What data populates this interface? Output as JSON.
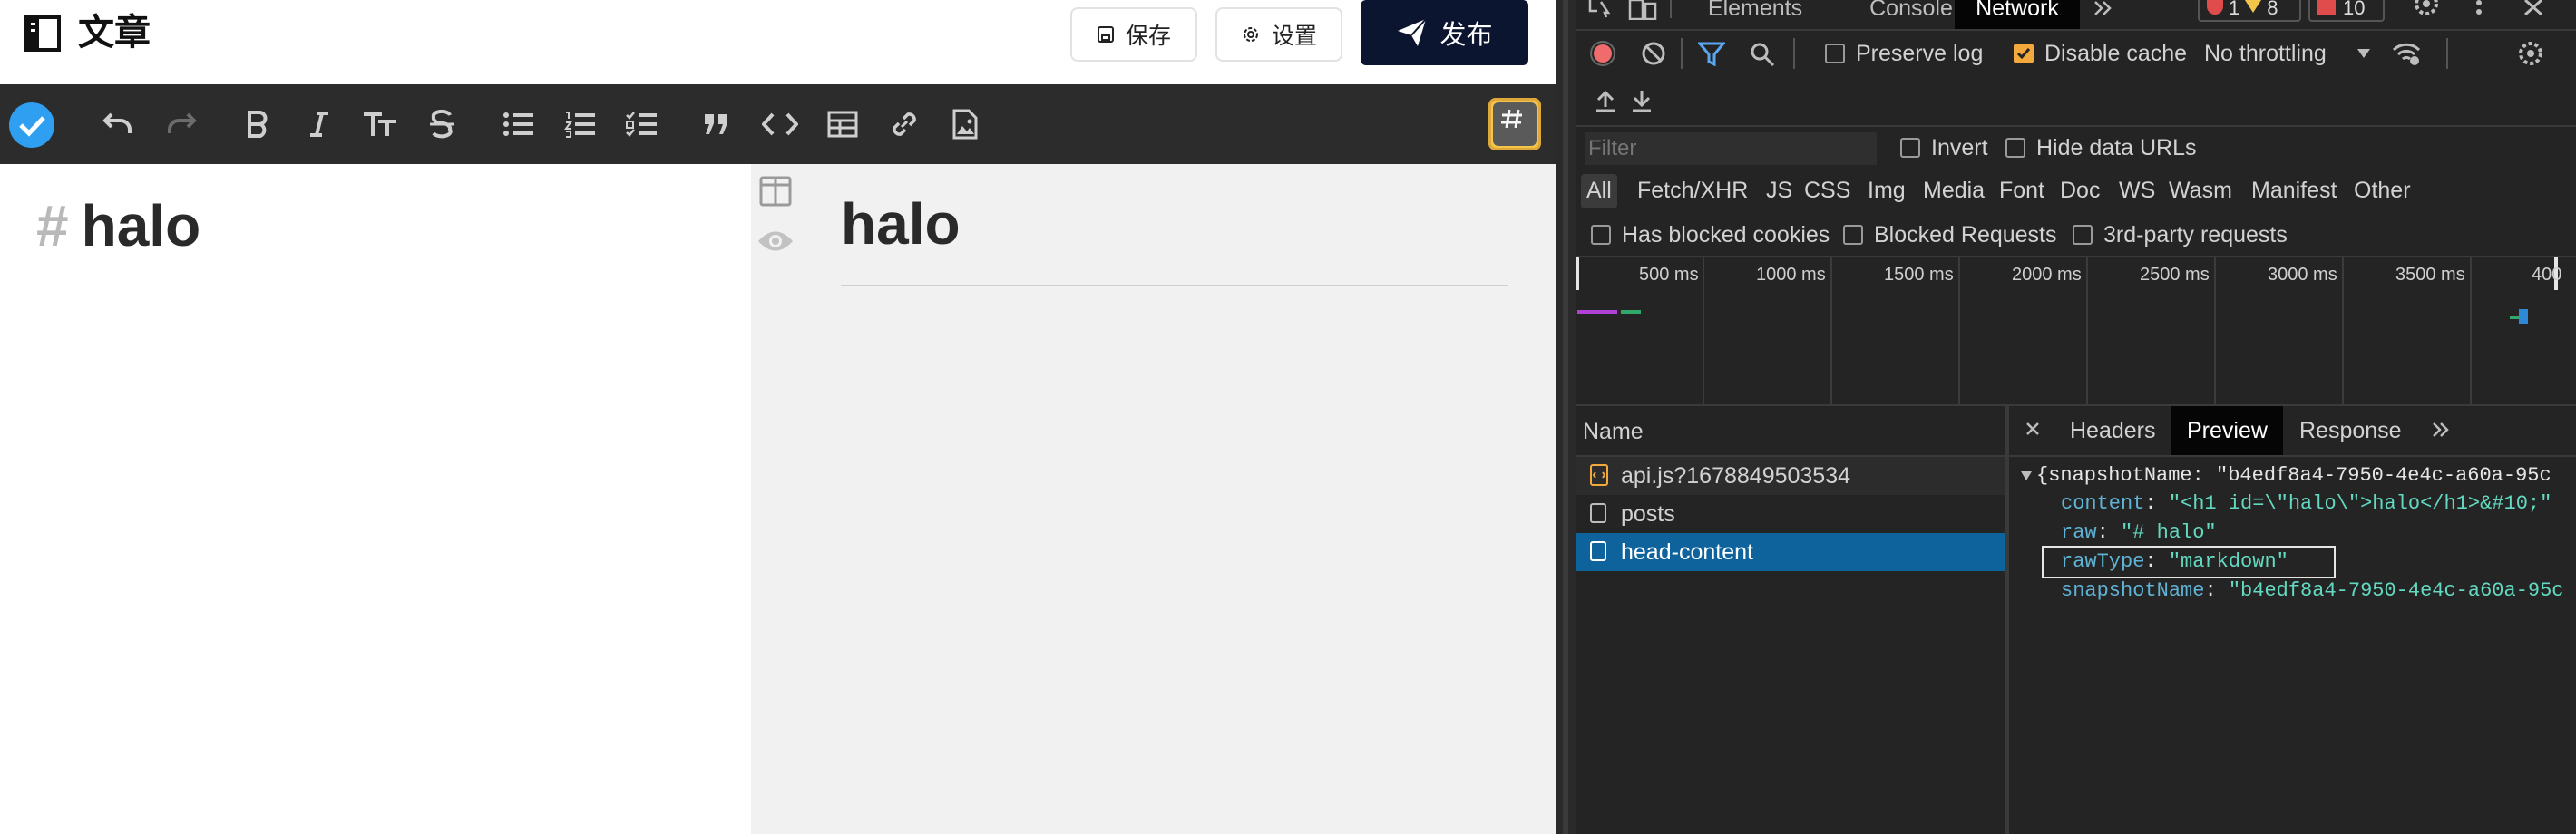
{
  "app": {
    "page_title": "文章",
    "buttons": {
      "save": "保存",
      "settings": "设置",
      "publish": "发布"
    },
    "editor": {
      "hash": "#",
      "heading": "halo"
    },
    "preview": {
      "heading": "halo"
    }
  },
  "devtools": {
    "tabs": [
      "Elements",
      "Console",
      "Network"
    ],
    "active_tab": "Network",
    "counts": {
      "errors": "1",
      "warnings": "8",
      "issues": "10"
    },
    "toolbar": {
      "preserve_log": "Preserve log",
      "disable_cache": "Disable cache",
      "throttling": "No throttling"
    },
    "filter": {
      "placeholder": "Filter",
      "invert": "Invert",
      "hide_data_urls": "Hide data URLs"
    },
    "types": [
      "All",
      "Fetch/XHR",
      "JS",
      "CSS",
      "Img",
      "Media",
      "Font",
      "Doc",
      "WS",
      "Wasm",
      "Manifest",
      "Other"
    ],
    "checks": {
      "blocked_cookies": "Has blocked cookies",
      "blocked_requests": "Blocked Requests",
      "third_party": "3rd-party requests"
    },
    "timeline_ticks": [
      "500 ms",
      "1000 ms",
      "1500 ms",
      "2000 ms",
      "2500 ms",
      "3000 ms",
      "3500 ms",
      "400"
    ],
    "requests": {
      "header": "Name",
      "items": [
        "api.js?1678849503534",
        "posts",
        "head-content"
      ],
      "selected": "head-content"
    },
    "detail_tabs": {
      "headers": "Headers",
      "preview": "Preview",
      "response": "Response"
    },
    "preview": {
      "root_open": "{snapshotName: \"b4edf8a4-7950-4e4c-a60a-95c",
      "rows": [
        {
          "key": "content",
          "value": "\"<h1 id=\\\"halo\\\">halo</h1>&#10;\""
        },
        {
          "key": "raw",
          "value": "\"# halo\""
        },
        {
          "key": "rawType",
          "value": "\"markdown\""
        },
        {
          "key": "snapshotName",
          "value": "\"b4edf8a4-7950-4e4c-a60a-95c"
        }
      ]
    },
    "colors": {
      "selected_row": "#0e639c",
      "record": "#f06b6b",
      "accent_orange": "#f3a93b"
    }
  }
}
